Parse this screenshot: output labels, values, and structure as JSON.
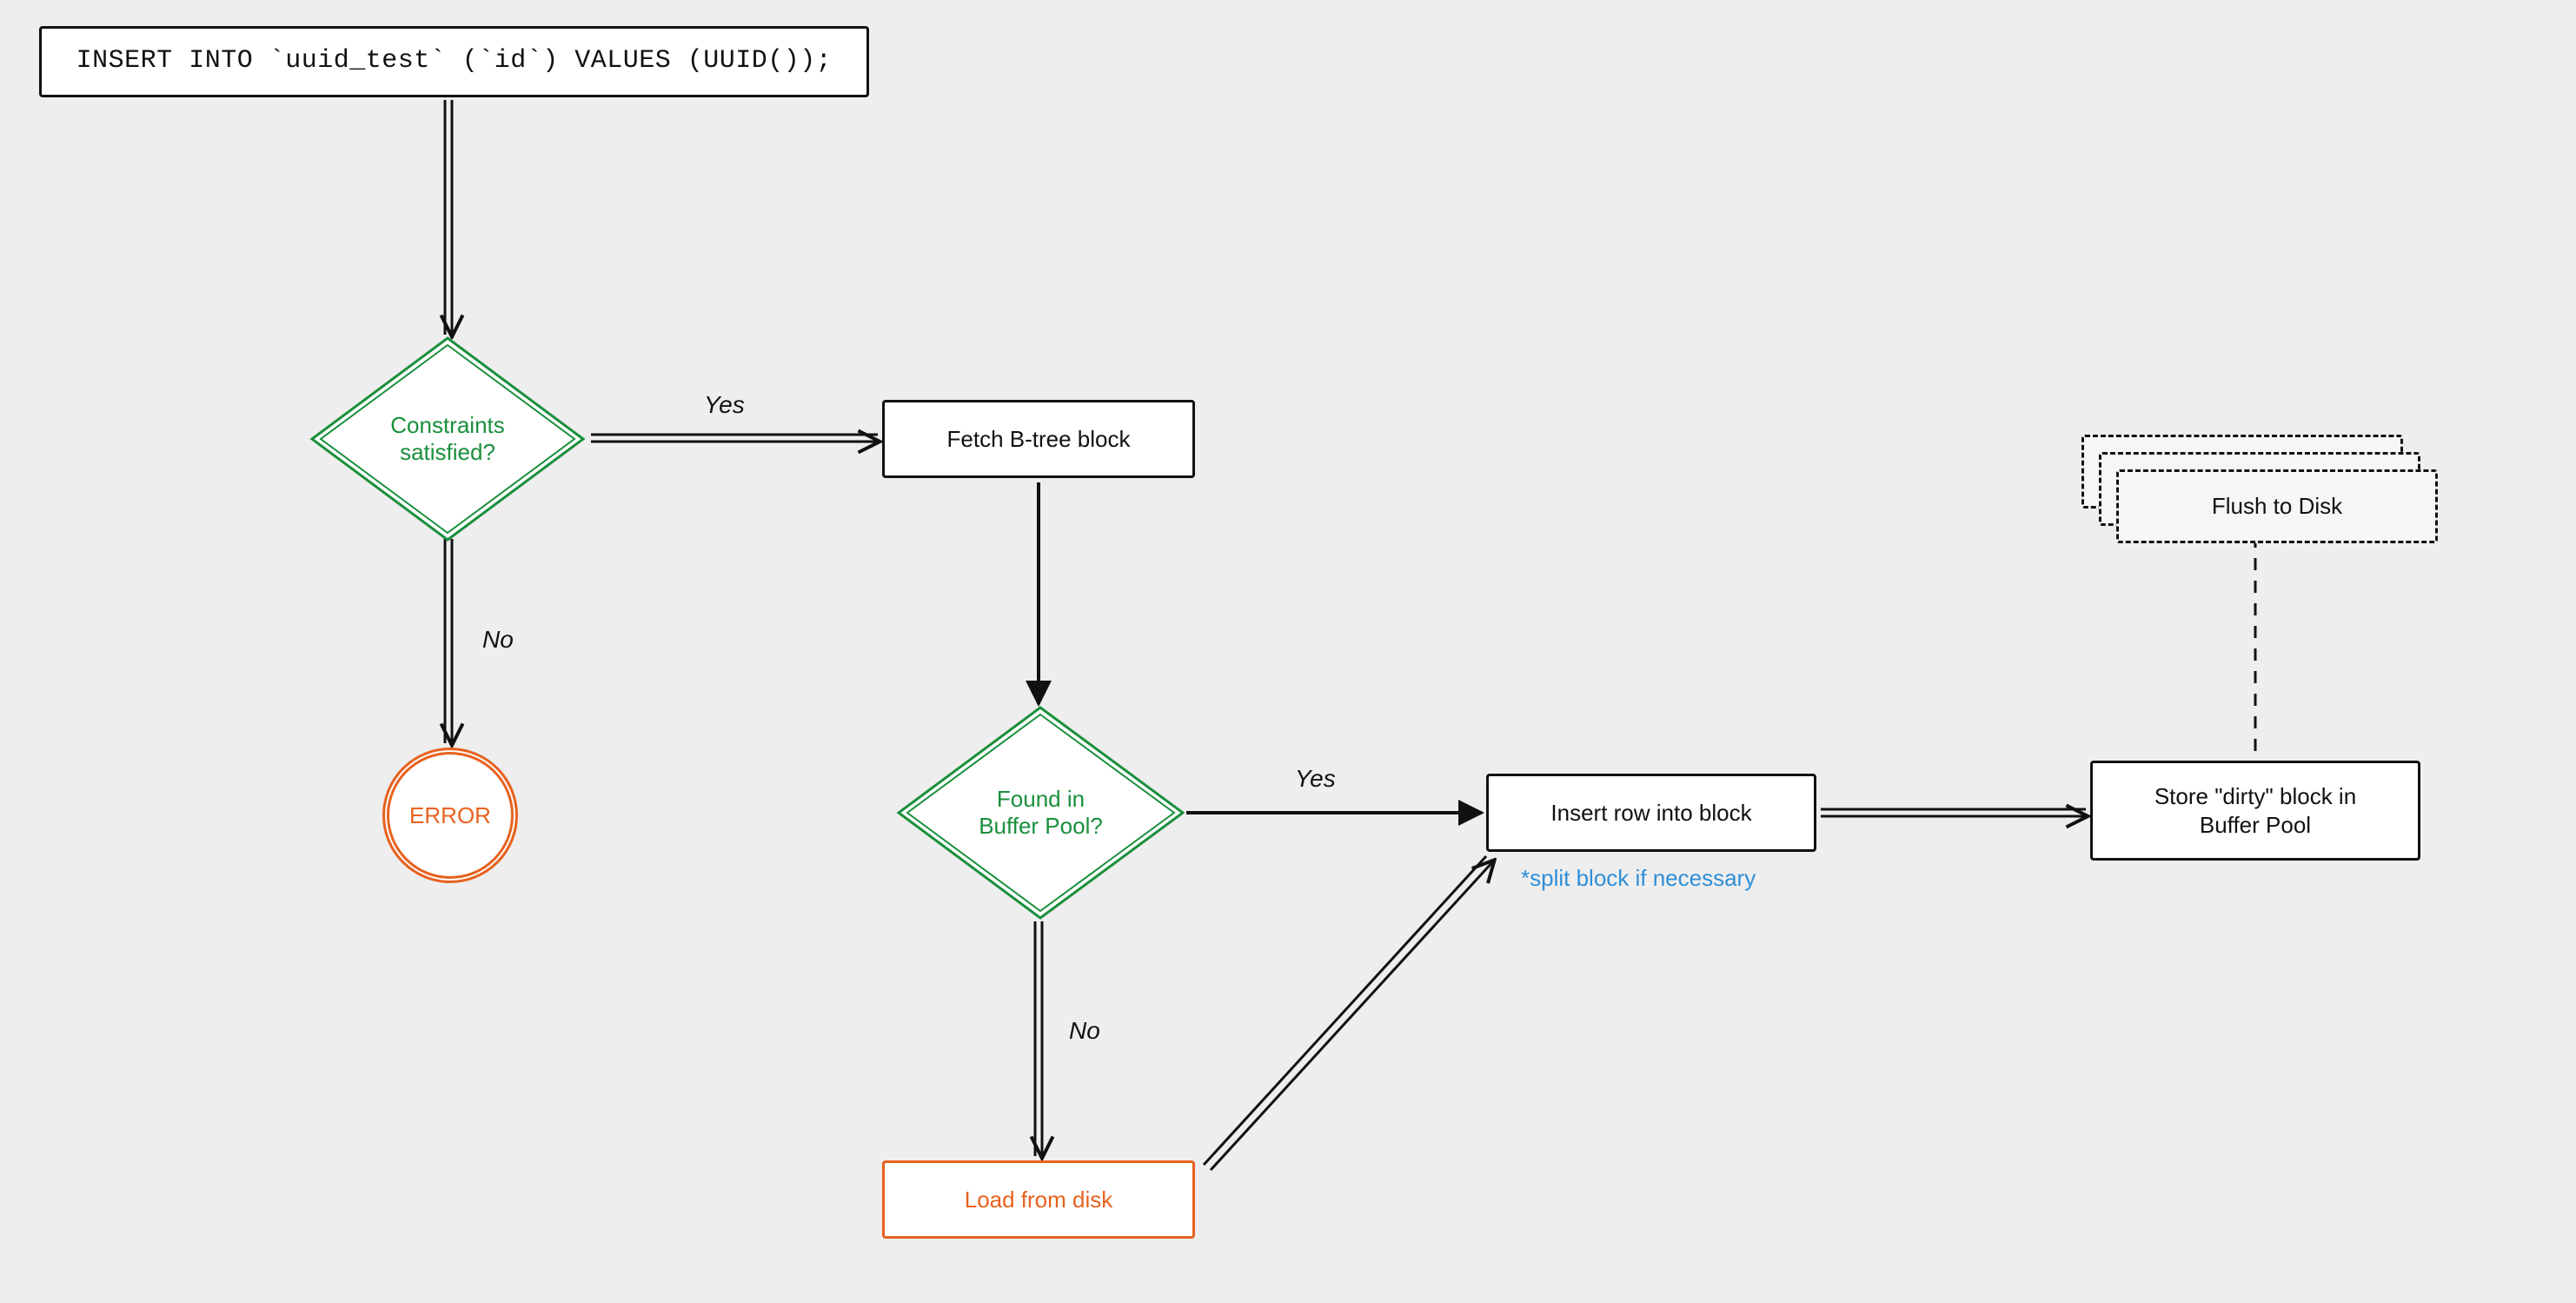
{
  "nodes": {
    "sql": {
      "text": "INSERT INTO `uuid_test` (`id`) VALUES (UUID());"
    },
    "constraints": {
      "text": "Constraints\nsatisfied?"
    },
    "error": {
      "text": "ERROR"
    },
    "fetch": {
      "text": "Fetch B-tree block"
    },
    "found": {
      "text": "Found in\nBuffer Pool?"
    },
    "load": {
      "text": "Load from disk"
    },
    "insert": {
      "text": "Insert row into block"
    },
    "insert_note": {
      "text": "*split block if necessary"
    },
    "store": {
      "text": "Store \"dirty\" block in\nBuffer Pool"
    },
    "flush": {
      "text": "Flush to Disk"
    }
  },
  "edges": {
    "constraints_yes": "Yes",
    "constraints_no": "No",
    "found_yes": "Yes",
    "found_no": "No"
  },
  "colors": {
    "stroke": "#111111",
    "green": "#1a8f3c",
    "orange": "#e7621f",
    "blue": "#2f8fd8",
    "bg": "#eeeeee"
  }
}
